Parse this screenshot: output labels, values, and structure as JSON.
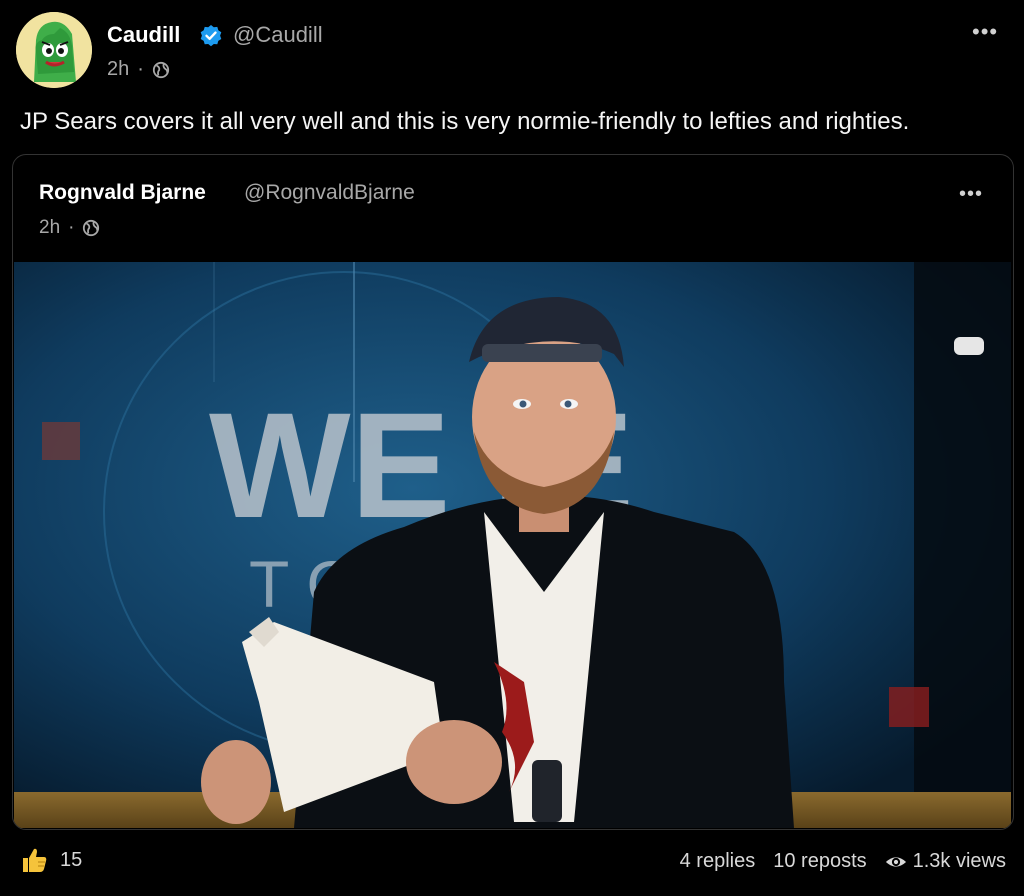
{
  "post": {
    "author_name": "Caudill",
    "author_handle": "@Caudill",
    "time": "2h",
    "separator": "·",
    "visibility_icon": "globe-icon",
    "verified_icon": "verified-badge-icon",
    "more_icon": "more-options-icon",
    "more_glyph": "•••",
    "text": "JP Sears covers it all very well and this is very normie-friendly to lefties and righties."
  },
  "quoted_post": {
    "author_name": "Rognvald Bjarne",
    "author_handle": "@RognvaldBjarne",
    "time": "2h",
    "separator": "·",
    "more_glyph": "•••",
    "media": {
      "type": "video-frame",
      "backdrop_title": "WE  IE",
      "backdrop_subtitle": "T O        U"
    }
  },
  "footer": {
    "like_icon": "thumbs-up-icon",
    "like_count": "15",
    "replies": "4 replies",
    "reposts": "10 reposts",
    "views_icon": "eye-icon",
    "views": "1.3k views"
  },
  "colors": {
    "background": "#000000",
    "verified": "#1d9bf0",
    "like": "#f5c33b",
    "muted_text": "#a8a8a8"
  }
}
